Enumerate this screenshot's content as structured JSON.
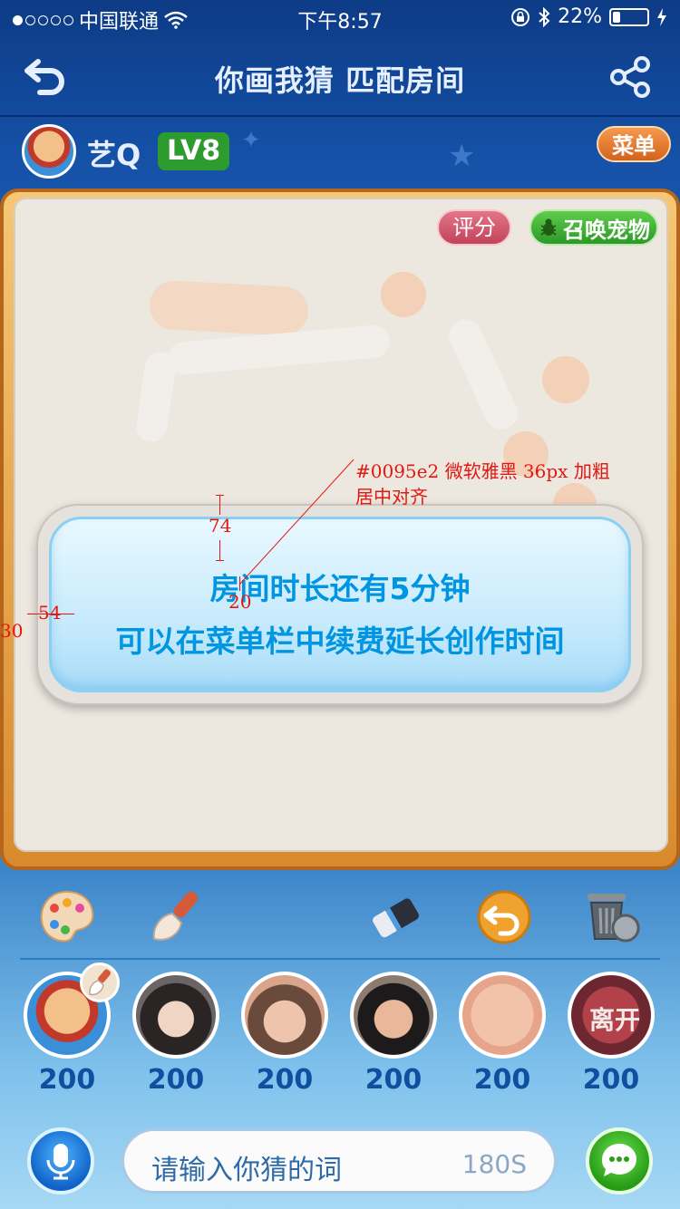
{
  "status_bar": {
    "carrier": "中国联通",
    "time": "下午8:57",
    "battery": "22%",
    "battery_level": 0.22,
    "signal_dots_filled": 1,
    "signal_dots_total": 5
  },
  "nav": {
    "title": "你画我猜  匹配房间",
    "back_icon": "undo-arrow-icon",
    "share_icon": "share-icon"
  },
  "user": {
    "name": "艺Q",
    "level": "LV8",
    "menu_label": "菜单"
  },
  "board": {
    "rate_label": "评分",
    "pet_label": "召唤宠物",
    "pet_icon": "bug-icon"
  },
  "notice": {
    "line1": "房间时长还有5分钟",
    "line2": "可以在菜单栏中续费延长创作时间",
    "color": "#0095e2"
  },
  "annotations": {
    "spec_line1": "#0095e2 微软雅黑 36px 加粗",
    "spec_line2": "居中对齐",
    "gap_top": "74",
    "gap_inner": "20",
    "gap_left": "54",
    "gap_edge": "30"
  },
  "tools": [
    {
      "icon": "palette-icon"
    },
    {
      "icon": "brush-icon"
    },
    {
      "icon": "eraser-icon"
    },
    {
      "icon": "undo-icon"
    },
    {
      "icon": "trash-icon"
    }
  ],
  "players": [
    {
      "score": "200",
      "label": ""
    },
    {
      "score": "200",
      "label": ""
    },
    {
      "score": "200",
      "label": ""
    },
    {
      "score": "200",
      "label": ""
    },
    {
      "score": "200",
      "label": ""
    },
    {
      "score": "200",
      "label": "离开"
    }
  ],
  "input": {
    "placeholder": "请输入你猜的词",
    "timer": "180S"
  },
  "colors": {
    "accent_blue": "#0095e2",
    "menu_orange": "#e07a2e",
    "level_green": "#2e9b2e",
    "annotation_red": "#e3170f"
  }
}
